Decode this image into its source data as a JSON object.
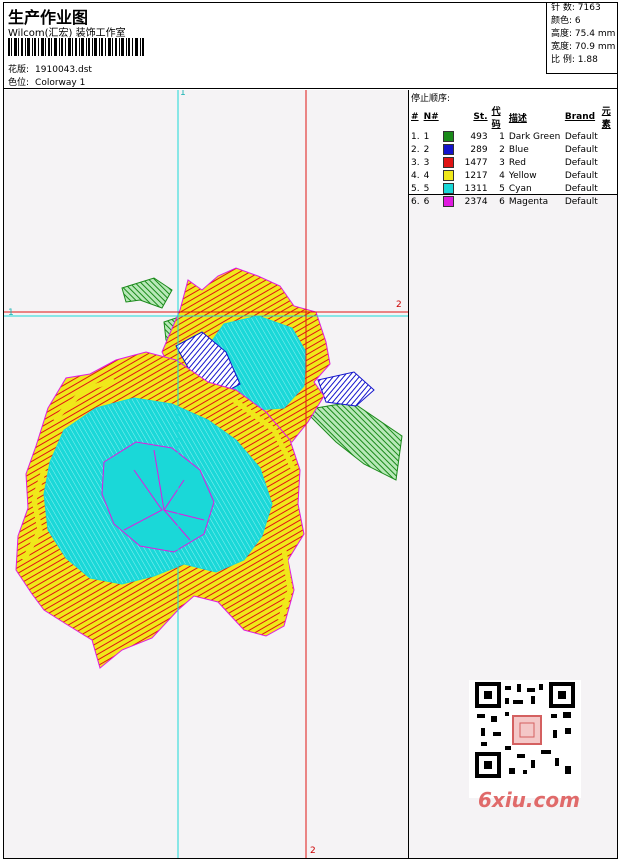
{
  "header": {
    "title": "生产作业图",
    "studio": "Wilcom(汇宏) 装饰工作室",
    "design_label": "花版:",
    "design_value": "1910043.dst",
    "colorway_label": "色位:",
    "colorway_value": "Colorway 1"
  },
  "stats": [
    {
      "label": "针 数:",
      "value": "7163"
    },
    {
      "label": "颜色:",
      "value": "6"
    },
    {
      "label": "高度:",
      "value": "75.4 mm"
    },
    {
      "label": "宽度:",
      "value": "70.9 mm"
    },
    {
      "label": "比 例:",
      "value": "1.88"
    }
  ],
  "sequence": {
    "title": "停止顺序:",
    "headers": [
      "#",
      "N#",
      "St.",
      "代码",
      "描述",
      "Brand",
      "元素"
    ],
    "rows": [
      {
        "num": "1.",
        "n": "1",
        "color": "#1a8a1a",
        "stitches": "493",
        "code": "1",
        "desc": "Dark Green",
        "brand": "Default"
      },
      {
        "num": "2.",
        "n": "2",
        "color": "#1414cc",
        "stitches": "289",
        "code": "2",
        "desc": "Blue",
        "brand": "Default"
      },
      {
        "num": "3.",
        "n": "3",
        "color": "#e01414",
        "stitches": "1477",
        "code": "3",
        "desc": "Red",
        "brand": "Default"
      },
      {
        "num": "4.",
        "n": "4",
        "color": "#f0e81a",
        "stitches": "1217",
        "code": "4",
        "desc": "Yellow",
        "brand": "Default"
      },
      {
        "num": "5.",
        "n": "5",
        "color": "#1ad8d8",
        "stitches": "1311",
        "code": "5",
        "desc": "Cyan",
        "brand": "Default"
      },
      {
        "num": "6.",
        "n": "6",
        "color": "#e01ae0",
        "stitches": "2374",
        "code": "6",
        "desc": "Magenta",
        "brand": "Default"
      }
    ]
  },
  "axes": {
    "v_cyan_top": "1",
    "h_cyan_left": "1",
    "h_red_right": "2",
    "v_red_bottom": "2"
  },
  "watermark": "6xiu.com"
}
